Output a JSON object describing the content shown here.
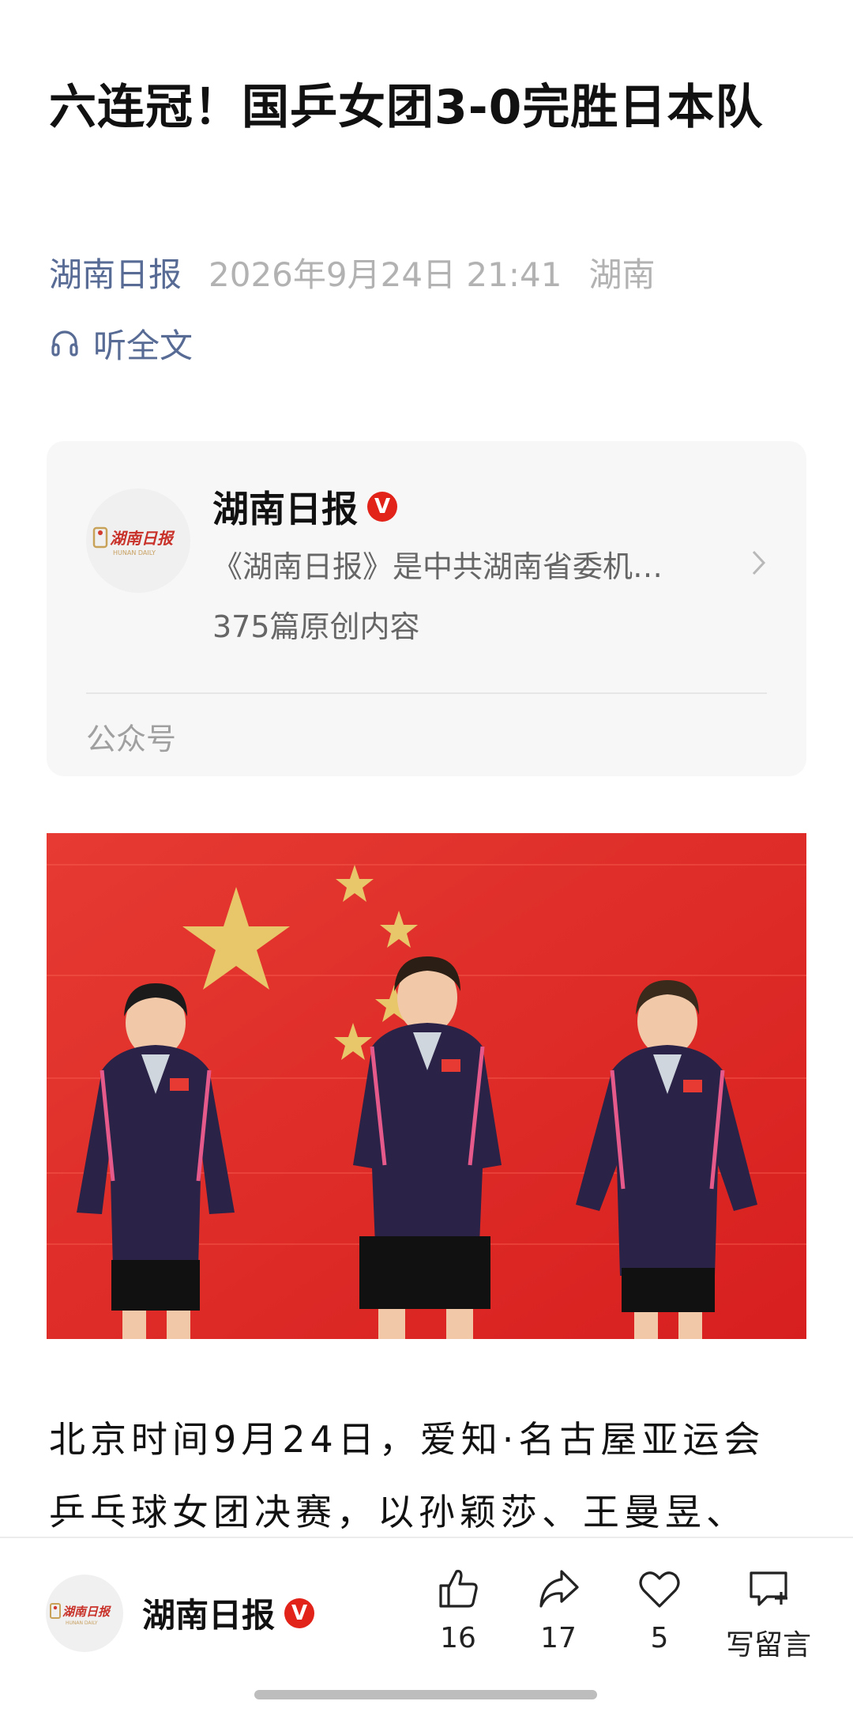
{
  "article": {
    "title": "六连冠！国乒女团3-0完胜日本队",
    "source": "湖南日报",
    "date": "2026年9月24日 21:41",
    "location": "湖南",
    "listen_label": "听全文"
  },
  "account_card": {
    "name": "湖南日报",
    "verified_badge": "V",
    "logo_text": "湖南日报",
    "logo_subtext": "HUNAN DAILY",
    "description": "《湖南日报》是中共湖南省委机…",
    "original_count": "375篇原创内容",
    "type_label": "公众号"
  },
  "body": {
    "line1": "北京时间9月24日，爱知·名古屋亚运会",
    "line2": "乒乓球女团决赛，以孙颖莎、王曼昱、"
  },
  "bottom_bar": {
    "name": "湖南日报",
    "verified_badge": "V",
    "like_count": "16",
    "share_count": "17",
    "favorite_count": "5",
    "comment_label": "写留言"
  },
  "colors": {
    "link_blue": "#576b95",
    "badge_red": "#e2231a",
    "flag_red": "#e02a25",
    "star_gold": "#e8c66a",
    "jacket_navy": "#2a2347"
  },
  "icons": {
    "listen": "headphones-icon",
    "chevron": "chevron-right-icon",
    "like": "thumbs-up-icon",
    "share": "share-arrow-icon",
    "favorite": "heart-icon",
    "comment": "comment-plus-icon"
  }
}
